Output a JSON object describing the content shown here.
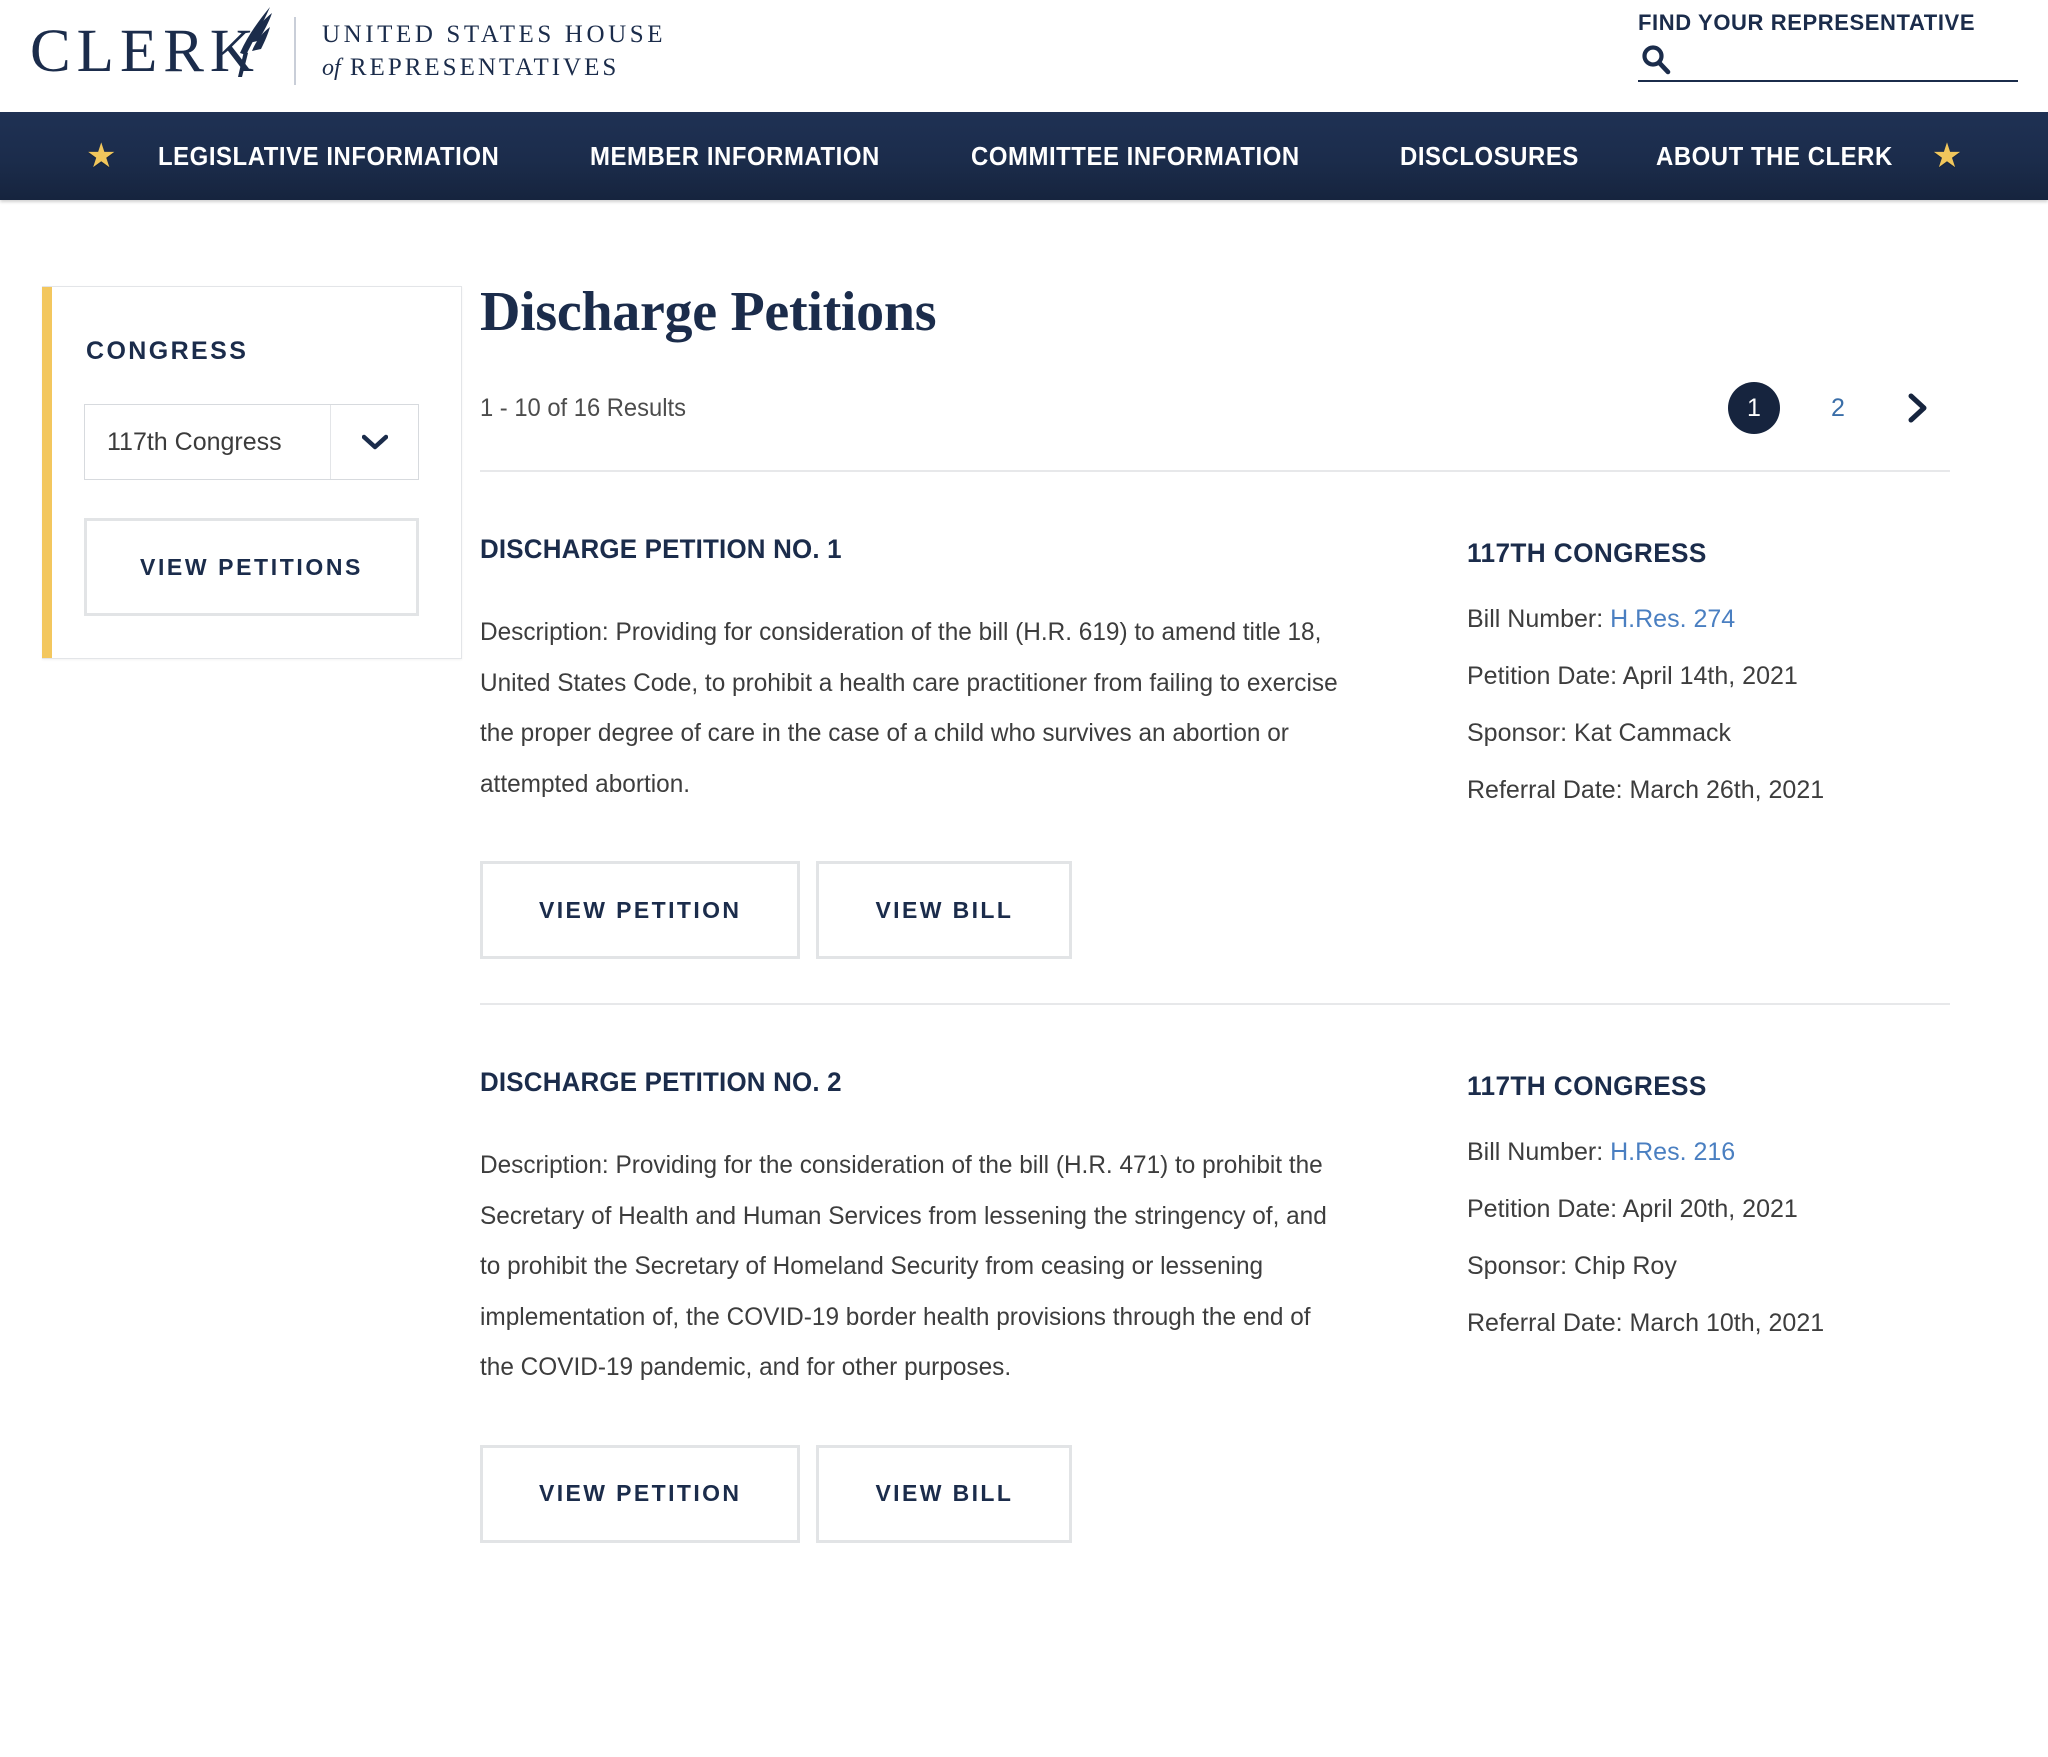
{
  "header": {
    "logo": {
      "wordmark": "CLERK",
      "subtitle_line1": "UNITED STATES HOUSE",
      "subtitle_of": "of",
      "subtitle_line2": "REPRESENTATIVES",
      "quill_icon": "quill-icon"
    },
    "find_rep": {
      "label": "FIND YOUR REPRESENTATIVE",
      "search_icon": "search-icon",
      "input_value": "",
      "placeholder": ""
    }
  },
  "nav": {
    "star_left": "star-icon",
    "star_right": "star-icon",
    "items": [
      {
        "label": "LEGISLATIVE INFORMATION"
      },
      {
        "label": "MEMBER INFORMATION"
      },
      {
        "label": "COMMITTEE INFORMATION"
      },
      {
        "label": "DISCLOSURES"
      },
      {
        "label": "ABOUT THE CLERK"
      }
    ]
  },
  "sidebar": {
    "filter_title": "CONGRESS",
    "congress_select": {
      "value": "117th Congress",
      "caret_icon": "chevron-down-icon"
    },
    "view_petitions_label": "VIEW PETITIONS"
  },
  "main": {
    "title": "Discharge Petitions",
    "results_count": "1 - 10 of 16 Results",
    "pagination": {
      "pages": [
        {
          "label": "1",
          "active": true
        },
        {
          "label": "2",
          "active": false
        }
      ],
      "next_icon": "chevron-right-icon"
    },
    "petitions": [
      {
        "title": "DISCHARGE PETITION NO. 1",
        "description": "Description: Providing for consideration of the bill (H.R. 619) to amend title 18, United States Code, to prohibit a health care practitioner from failing to exercise the proper degree of care in the case of a child who survives an abortion or attempted abortion.",
        "view_petition_label": "VIEW PETITION",
        "view_bill_label": "VIEW BILL",
        "meta": {
          "congress": "117TH CONGRESS",
          "bill_number_label": "Bill Number:",
          "bill_number_value": "H.Res. 274",
          "petition_date": "Petition Date: April 14th, 2021",
          "sponsor": "Sponsor: Kat Cammack",
          "referral_date": "Referral Date: March 26th, 2021"
        }
      },
      {
        "title": "DISCHARGE PETITION NO. 2",
        "description": "Description: Providing for the consideration of the bill (H.R. 471) to prohibit the Secretary of Health and Human Services from lessening the stringency of, and to prohibit the Secretary of Homeland Security from ceasing or lessening implementation of, the COVID-19 border health provisions through the end of the COVID-19 pandemic, and for other purposes.",
        "view_petition_label": "VIEW PETITION",
        "view_bill_label": "VIEW BILL",
        "meta": {
          "congress": "117TH CONGRESS",
          "bill_number_label": "Bill Number:",
          "bill_number_value": "H.Res. 216",
          "petition_date": "Petition Date: April 20th, 2021",
          "sponsor": "Sponsor: Chip Roy",
          "referral_date": "Referral Date: March 10th, 2021"
        }
      }
    ]
  },
  "colors": {
    "navy": "#1b2c4b",
    "nav_bar": "#1f3154",
    "gold": "#f3c75e",
    "link_blue": "#4a7fc1",
    "border_gray": "#e2e4e6"
  }
}
